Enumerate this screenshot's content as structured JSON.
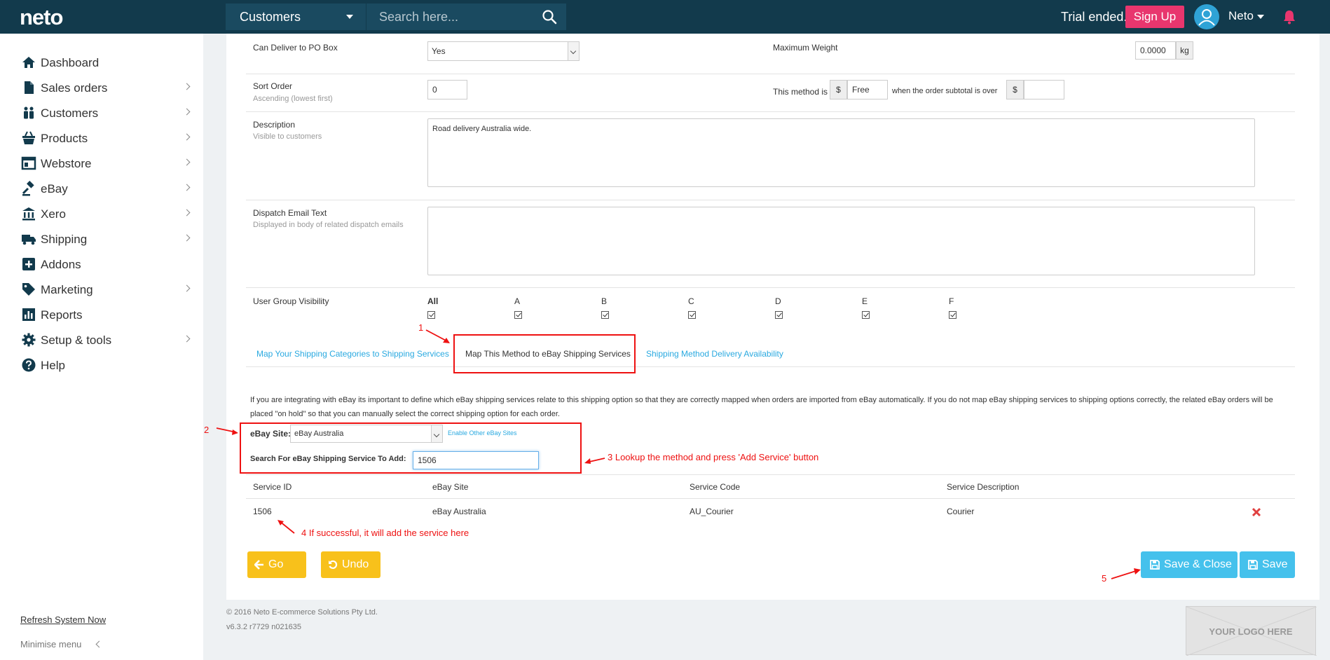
{
  "topbar": {
    "logo": "neto",
    "section_select": "Customers",
    "search_placeholder": "Search here...",
    "trial_text": "Trial ended.",
    "signup_label": "Sign Up",
    "user_name": "Neto"
  },
  "sidebar": {
    "items": [
      {
        "label": "Dashboard",
        "icon": "home-icon",
        "chevron": false
      },
      {
        "label": "Sales orders",
        "icon": "document-icon",
        "chevron": true
      },
      {
        "label": "Customers",
        "icon": "people-icon",
        "chevron": true
      },
      {
        "label": "Products",
        "icon": "basket-icon",
        "chevron": true
      },
      {
        "label": "Webstore",
        "icon": "window-icon",
        "chevron": true
      },
      {
        "label": "eBay",
        "icon": "gavel-icon",
        "chevron": true
      },
      {
        "label": "Xero",
        "icon": "bank-icon",
        "chevron": true
      },
      {
        "label": "Shipping",
        "icon": "truck-icon",
        "chevron": true
      },
      {
        "label": "Addons",
        "icon": "plus-square-icon",
        "chevron": false
      },
      {
        "label": "Marketing",
        "icon": "tag-icon",
        "chevron": true
      },
      {
        "label": "Reports",
        "icon": "bar-chart-icon",
        "chevron": false
      },
      {
        "label": "Setup & tools",
        "icon": "gear-icon",
        "chevron": true
      },
      {
        "label": "Help",
        "icon": "question-icon",
        "chevron": false
      }
    ],
    "refresh_label": "Refresh System Now",
    "minimise_label": "Minimise menu"
  },
  "form": {
    "po_box_label": "Can Deliver to PO Box",
    "po_box_value": "Yes",
    "max_weight_label": "Maximum Weight",
    "max_weight_value": "0.0000",
    "max_weight_unit": "kg",
    "sort_order_label": "Sort Order",
    "sort_order_sub": "Ascending (lowest first)",
    "sort_order_value": "0",
    "method_is_label": "This method is",
    "currency_symbol": "$",
    "method_price_value": "Free",
    "subtotal_label": "when the order subtotal is over",
    "subtotal_currency": "$",
    "subtotal_value": "",
    "description_label": "Description",
    "description_sub": "Visible to customers",
    "description_value": "Road delivery Australia wide.",
    "dispatch_label": "Dispatch Email Text",
    "dispatch_sub": "Displayed in body of related dispatch emails",
    "dispatch_value": "",
    "user_group_label": "User Group Visibility",
    "user_groups": [
      "All",
      "A",
      "B",
      "C",
      "D",
      "E",
      "F"
    ]
  },
  "tabs": [
    {
      "label": "Map Your Shipping Categories to Shipping Services",
      "active": false
    },
    {
      "label": "Map This Method to eBay Shipping Services",
      "active": true
    },
    {
      "label": "Shipping Method Delivery Availability",
      "active": false
    }
  ],
  "ebay": {
    "info": "If you are integrating with eBay its important to define which eBay shipping services relate to this shipping option so that they are correctly mapped when orders are imported from eBay automatically. If you do not map eBay shipping services to shipping options correctly, the related eBay orders will be placed \"on hold\" so that you can manually select the correct shipping option for each order.",
    "site_label": "eBay Site:",
    "site_value": "eBay Australia",
    "enable_link": "Enable Other eBay Sites",
    "search_label": "Search For eBay Shipping Service To Add:",
    "search_value": "1506"
  },
  "table": {
    "headers": [
      "Service ID",
      "eBay Site",
      "Service Code",
      "Service Description"
    ],
    "rows": [
      {
        "service_id": "1506",
        "ebay_site": "eBay Australia",
        "service_code": "AU_Courier",
        "service_description": "Courier"
      }
    ]
  },
  "buttons": {
    "go_back": "Go Back",
    "undo": "Undo",
    "save_close": "Save & Close",
    "save": "Save"
  },
  "annotations": {
    "n1": "1",
    "n2": "2",
    "n3": "3 Lookup the method and press 'Add Service' button",
    "n4": "4 If successful, it will add the service here",
    "n5": "5"
  },
  "footer": {
    "copyright": "© 2016 Neto E-commerce Solutions Pty Ltd.",
    "version": "v6.3.2 r7729 n021635",
    "logo_placeholder": "YOUR LOGO HERE"
  },
  "colors": {
    "topbar": "#123a4c",
    "accent_pink": "#e8366e",
    "link_blue": "#29a9e0",
    "button_yellow": "#f8c11b",
    "button_blue": "#45c1ec",
    "annotation_red": "#ee1111"
  }
}
